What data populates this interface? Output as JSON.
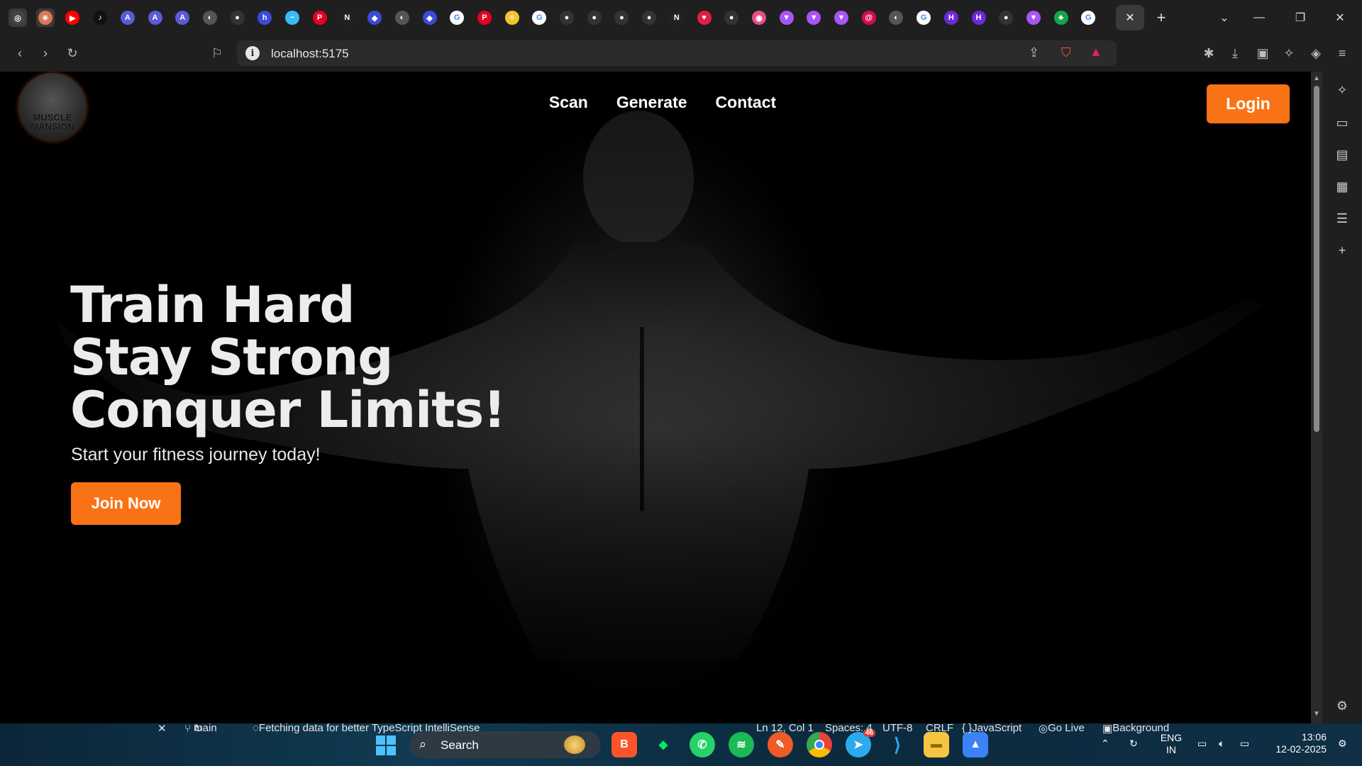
{
  "browser": {
    "url": "localhost:5175",
    "close_tab_glyph": "✕",
    "new_tab_glyph": "+",
    "tabs": [
      {
        "icon": "chatgpt-icon",
        "glyph": "◎",
        "color": "#444"
      },
      {
        "icon": "claude-icon",
        "glyph": "✳",
        "color": "#d97757"
      },
      {
        "icon": "youtube-icon",
        "glyph": "▶",
        "color": "#ff0000"
      },
      {
        "icon": "tiktok-icon",
        "glyph": "♪",
        "color": "#111"
      },
      {
        "icon": "arc-icon",
        "glyph": "A",
        "color": "#5b5bd6"
      },
      {
        "icon": "arc-icon",
        "glyph": "A",
        "color": "#5b5bd6"
      },
      {
        "icon": "arc-icon",
        "glyph": "A",
        "color": "#5b5bd6"
      },
      {
        "icon": "globe-icon",
        "glyph": "◐",
        "color": "#555"
      },
      {
        "icon": "github-icon",
        "glyph": "●",
        "color": "#333"
      },
      {
        "icon": "hashnode-icon",
        "glyph": "h",
        "color": "#3b4bd8"
      },
      {
        "icon": "tailwind-icon",
        "glyph": "~",
        "color": "#38bdf8"
      },
      {
        "icon": "pinterest-icon",
        "glyph": "P",
        "color": "#e60023"
      },
      {
        "icon": "notion-icon",
        "glyph": "N",
        "color": "#222"
      },
      {
        "icon": "drive-icon",
        "glyph": "◆",
        "color": "#3b4bd8"
      },
      {
        "icon": "globe-icon",
        "glyph": "◐",
        "color": "#555"
      },
      {
        "icon": "drive-icon",
        "glyph": "◆",
        "color": "#3b4bd8"
      },
      {
        "icon": "google-icon",
        "glyph": "G",
        "color": "#fff"
      },
      {
        "icon": "pinterest-icon",
        "glyph": "P",
        "color": "#e60023"
      },
      {
        "icon": "stack-icon",
        "glyph": "≡",
        "color": "#f4c430"
      },
      {
        "icon": "google-icon",
        "glyph": "G",
        "color": "#fff"
      },
      {
        "icon": "github-icon",
        "glyph": "●",
        "color": "#333"
      },
      {
        "icon": "github-icon",
        "glyph": "●",
        "color": "#333"
      },
      {
        "icon": "github-icon",
        "glyph": "●",
        "color": "#333"
      },
      {
        "icon": "github-icon",
        "glyph": "●",
        "color": "#333"
      },
      {
        "icon": "notion-icon",
        "glyph": "N",
        "color": "#222"
      },
      {
        "icon": "heart-icon",
        "glyph": "♥",
        "color": "#e11d48"
      },
      {
        "icon": "github-icon",
        "glyph": "●",
        "color": "#333"
      },
      {
        "icon": "dribbble-icon",
        "glyph": "◉",
        "color": "#ea4c89"
      },
      {
        "icon": "vite-icon",
        "glyph": "▼",
        "color": "#a855f7"
      },
      {
        "icon": "vite-icon",
        "glyph": "▼",
        "color": "#a855f7"
      },
      {
        "icon": "vite-icon",
        "glyph": "▼",
        "color": "#a855f7"
      },
      {
        "icon": "debian-icon",
        "glyph": "@",
        "color": "#d70a53"
      },
      {
        "icon": "globe-icon",
        "glyph": "◐",
        "color": "#555"
      },
      {
        "icon": "google-icon",
        "glyph": "G",
        "color": "#fff"
      },
      {
        "icon": "hyper-icon",
        "glyph": "H",
        "color": "#6d28d9"
      },
      {
        "icon": "hyper-icon",
        "glyph": "H",
        "color": "#6d28d9"
      },
      {
        "icon": "github-icon",
        "glyph": "●",
        "color": "#333"
      },
      {
        "icon": "vite-icon",
        "glyph": "▼",
        "color": "#a855f7"
      },
      {
        "icon": "tree-icon",
        "glyph": "♣",
        "color": "#16a34a"
      },
      {
        "icon": "google-icon",
        "glyph": "G",
        "color": "#fff"
      }
    ]
  },
  "site": {
    "logo_text": "MUSCLE\nMANSION",
    "nav": [
      "Scan",
      "Generate",
      "Contact"
    ],
    "login_label": "Login",
    "headline": [
      "Train Hard",
      "Stay Strong",
      "Conquer Limits!"
    ],
    "subline": "Start your fitness journey today!",
    "cta_label": "Join Now",
    "accent_color": "#f97316"
  },
  "vscode_status": {
    "branch": "main",
    "message": "Fetching data for better TypeScript IntelliSense",
    "position": "Ln 12, Col 1",
    "spaces": "Spaces: 4",
    "encoding": "UTF-8",
    "eol": "CRLF",
    "language": "JavaScript",
    "go_live": "Go Live",
    "background": "Background"
  },
  "taskbar": {
    "search_label": "Search",
    "telegram_badge": "46",
    "lang_top": "ENG",
    "lang_bottom": "IN",
    "time": "13:06",
    "date": "12-02-2025"
  }
}
